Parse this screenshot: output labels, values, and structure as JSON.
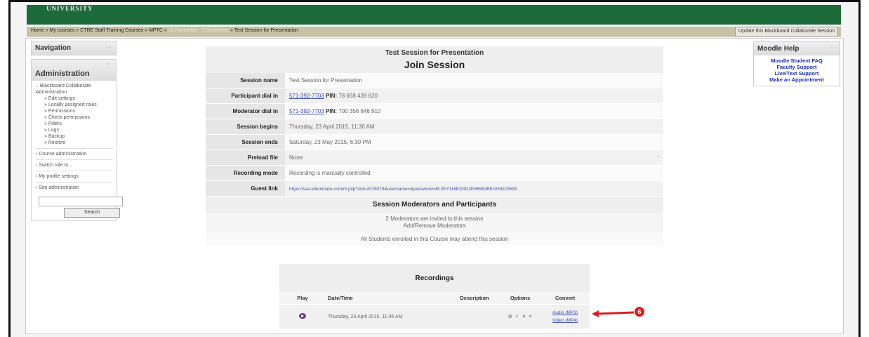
{
  "header": {
    "brand": "UNIVERSITY",
    "color": "#1d6b3a"
  },
  "breadcrumb": {
    "items": [
      "Home",
      "My courses",
      "CTRE Staff Training Courses",
      "MPTC"
    ],
    "highlighted": [
      "20 November - 3 December"
    ],
    "last": "Test Session for Presentation",
    "separator": "»",
    "update_button": "Update this Blackboard Collaborate Session"
  },
  "navigation": {
    "title": "Navigation"
  },
  "administration": {
    "title": "Administration",
    "root": "Blackboard Collaborate Administration",
    "items": [
      "Edit settings",
      "Locally assigned roles",
      "Permissions",
      "Check permissions",
      "Filters",
      "Logs",
      "Backup",
      "Restore"
    ],
    "sections": [
      "Course administration",
      "Switch role to...",
      "My profile settings",
      "Site administration"
    ],
    "search_button": "Search"
  },
  "session": {
    "subtitle": "Test Session for Presentation",
    "title": "Join Session",
    "rows": [
      {
        "label": "Session name",
        "value": "Test Session for Presentation"
      },
      {
        "label": "Participant dial in",
        "phone": "571-392-7703",
        "pin_label": "PIN:",
        "pin": "78 658 439 620"
      },
      {
        "label": "Moderator dial in",
        "phone": "571-392-7703",
        "pin_label": "PIN:",
        "pin": "700 356 646 910"
      },
      {
        "label": "Session begins",
        "value": "Thursday, 23 April 2015, 11:30 AM"
      },
      {
        "label": "Session ends",
        "value": "Saturday, 23 May 2015, 6:30 PM"
      },
      {
        "label": "Preload file",
        "value": "None"
      },
      {
        "label": "Recording mode",
        "value": "Recording is manually controlled"
      },
      {
        "label": "Guest link",
        "link": "https://sas.elluminate.com/m.jnlp?sid=2015070&username=&password=M.2E7316ED0D2E96562BE1E5D20593"
      }
    ]
  },
  "participants": {
    "title": "Session Moderators and Participants",
    "invited": "2 Moderators are invited to this session",
    "add_remove": "Add/Remove Moderators",
    "students": "All Students enrolled in this Course may attend this session"
  },
  "recordings": {
    "title": "Recordings",
    "columns": [
      "Play",
      "Date/Time",
      "Description",
      "Options",
      "Convert"
    ],
    "rows": [
      {
        "datetime": "Thursday, 23 April 2015, 11:45 AM",
        "description": "",
        "options": "⚙ ✓ ✕ ≡",
        "audio": "Audio (MP3)",
        "video": "Video (MP4)"
      }
    ]
  },
  "callout": {
    "number": "6",
    "color": "#d62020"
  },
  "moodle_help": {
    "title": "Moodle Help",
    "links": [
      "Moodle Student FAQ",
      "Faculty Support",
      "Live/Text Support",
      "Make an Appointment"
    ]
  }
}
